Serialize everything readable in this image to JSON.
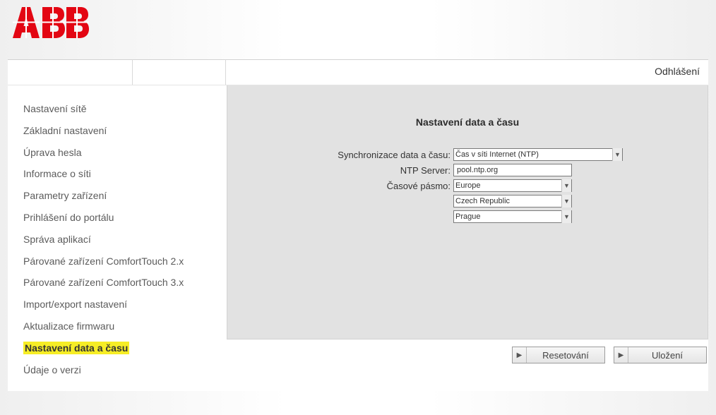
{
  "brand": {
    "name": "ABB",
    "color": "#e30613"
  },
  "header": {
    "logout": "Odhlášení"
  },
  "sidebar": {
    "items": [
      {
        "label": "Nastavení sítě"
      },
      {
        "label": "Základní nastavení"
      },
      {
        "label": "Úprava hesla"
      },
      {
        "label": "Informace o síti"
      },
      {
        "label": "Parametry zařízení"
      },
      {
        "label": "Prihlášení do portálu"
      },
      {
        "label": "Správa aplikací"
      },
      {
        "label": "Párované zařízení ComfortTouch 2.x"
      },
      {
        "label": "Párované zařízení ComfortTouch 3.x"
      },
      {
        "label": "Import/export nastavení"
      },
      {
        "label": "Aktualizace firmwaru"
      },
      {
        "label": "Nastavení data a času"
      },
      {
        "label": "Údaje o verzi"
      }
    ],
    "active_index": 11
  },
  "content": {
    "title": "Nastavení data a času",
    "rows": {
      "sync": {
        "label": "Synchronizace data a času:",
        "value": "Čas v síti Internet (NTP)"
      },
      "ntp": {
        "label": "NTP Server:",
        "value": "pool.ntp.org"
      },
      "timezone": {
        "label": "Časové pásmo:",
        "value": "Europe"
      },
      "country": {
        "value": "Czech Republic"
      },
      "city": {
        "value": "Prague"
      }
    }
  },
  "buttons": {
    "reset": "Resetování",
    "save": "Uložení"
  }
}
